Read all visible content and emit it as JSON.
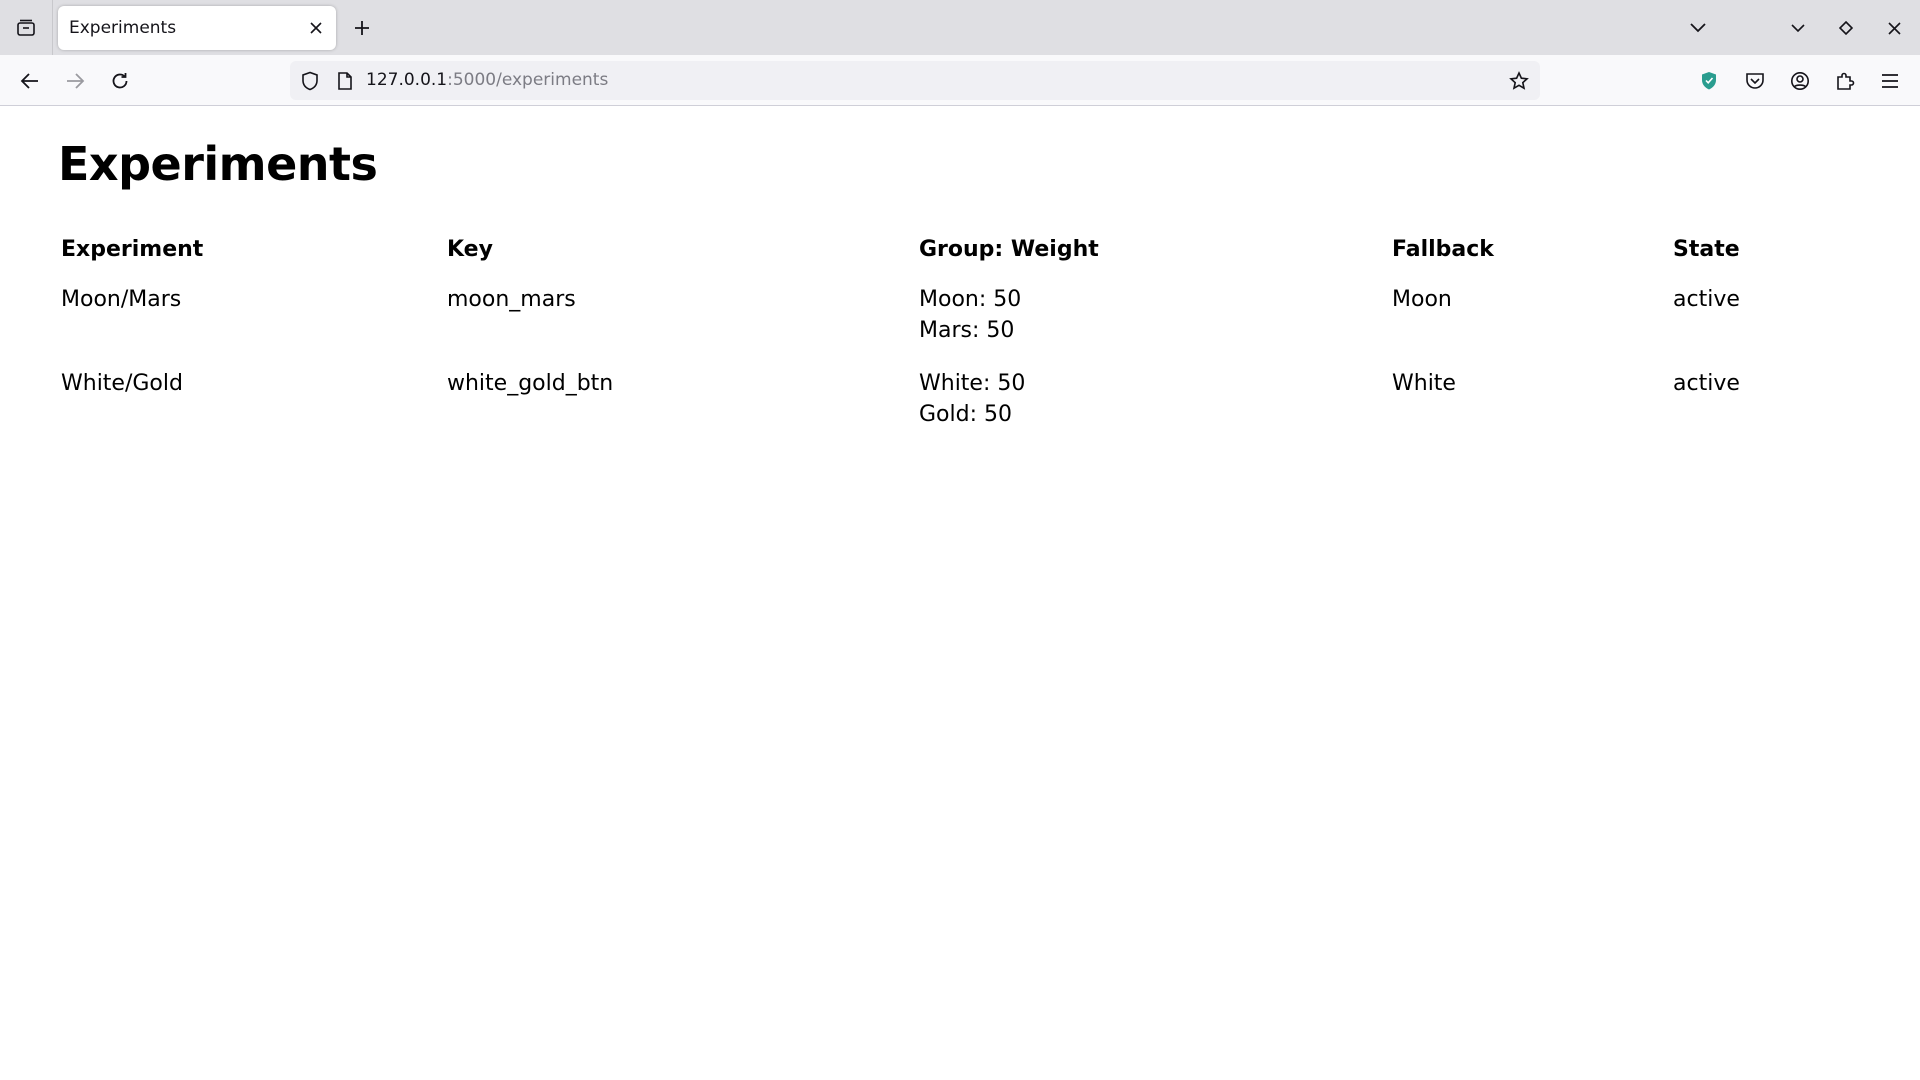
{
  "browser": {
    "tab": {
      "title": "Experiments"
    },
    "url": {
      "host": "127.0.0.1",
      "rest": ":5000/experiments"
    }
  },
  "page": {
    "title": "Experiments",
    "table": {
      "headers": {
        "experiment": "Experiment",
        "key": "Key",
        "groups": "Group: Weight",
        "fallback": "Fallback",
        "state": "State"
      },
      "rows": [
        {
          "experiment": "Moon/Mars",
          "key": "moon_mars",
          "groups": [
            "Moon: 50",
            "Mars: 50"
          ],
          "fallback": "Moon",
          "state": "active"
        },
        {
          "experiment": "White/Gold",
          "key": "white_gold_btn",
          "groups": [
            "White: 50",
            "Gold: 50"
          ],
          "fallback": "White",
          "state": "active"
        }
      ]
    }
  },
  "colors": {
    "tabbar_bg": "#dfdfe3",
    "navbar_bg": "#f9f9fb",
    "urlbar_bg": "#f0f0f4",
    "shield_accent": "#2a9d8f"
  }
}
